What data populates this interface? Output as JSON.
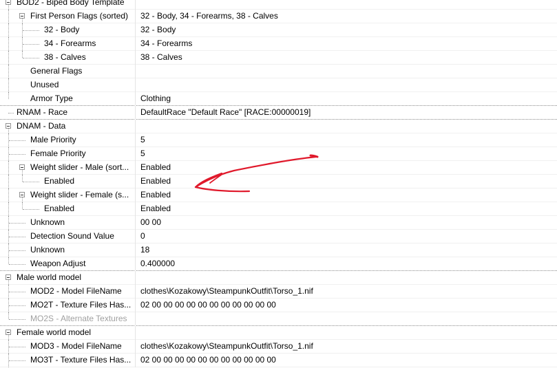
{
  "rows": [
    {
      "name": "BOD2 - Biped Body Template",
      "value": ""
    },
    {
      "name": "First Person Flags (sorted)",
      "value": "32 - Body, 34 - Forearms, 38 - Calves"
    },
    {
      "name": "32 - Body",
      "value": "32 - Body"
    },
    {
      "name": "34 - Forearms",
      "value": "34 - Forearms"
    },
    {
      "name": "38 - Calves",
      "value": "38 - Calves"
    },
    {
      "name": "General Flags",
      "value": ""
    },
    {
      "name": "Unused",
      "value": ""
    },
    {
      "name": "Armor Type",
      "value": "Clothing"
    },
    {
      "name": "RNAM - Race",
      "value": "DefaultRace \"Default Race\" [RACE:00000019]"
    },
    {
      "name": "DNAM - Data",
      "value": ""
    },
    {
      "name": "Male Priority",
      "value": "5"
    },
    {
      "name": "Female Priority",
      "value": "5"
    },
    {
      "name": "Weight slider - Male (sort...",
      "value": "Enabled"
    },
    {
      "name": "Enabled",
      "value": "Enabled"
    },
    {
      "name": "Weight slider - Female (s...",
      "value": "Enabled"
    },
    {
      "name": "Enabled",
      "value": "Enabled"
    },
    {
      "name": "Unknown",
      "value": "00 00"
    },
    {
      "name": "Detection Sound Value",
      "value": "0"
    },
    {
      "name": "Unknown",
      "value": "18"
    },
    {
      "name": "Weapon Adjust",
      "value": "0.400000"
    },
    {
      "name": "Male world model",
      "value": ""
    },
    {
      "name": "MOD2 - Model FileName",
      "value": "clothes\\Kozakowy\\SteampunkOutfit\\Torso_1.nif"
    },
    {
      "name": "MO2T - Texture Files Has...",
      "value": "02 00 00 00 00 00 00 00 00 00 00 00"
    },
    {
      "name": "MO2S - Alternate Textures",
      "value": ""
    },
    {
      "name": "Female world model",
      "value": ""
    },
    {
      "name": "MOD3 - Model FileName",
      "value": "clothes\\Kozakowy\\SteampunkOutfit\\Torso_1.nif"
    },
    {
      "name": "MO3T - Texture Files Has...",
      "value": "02 00 00 00 00 00 00 00 00 00 00 00"
    }
  ],
  "colors": {
    "annotation_arrow": "#e0192b",
    "tree_lines": "#a0a0a0",
    "disabled_text": "#a0a0a0"
  }
}
